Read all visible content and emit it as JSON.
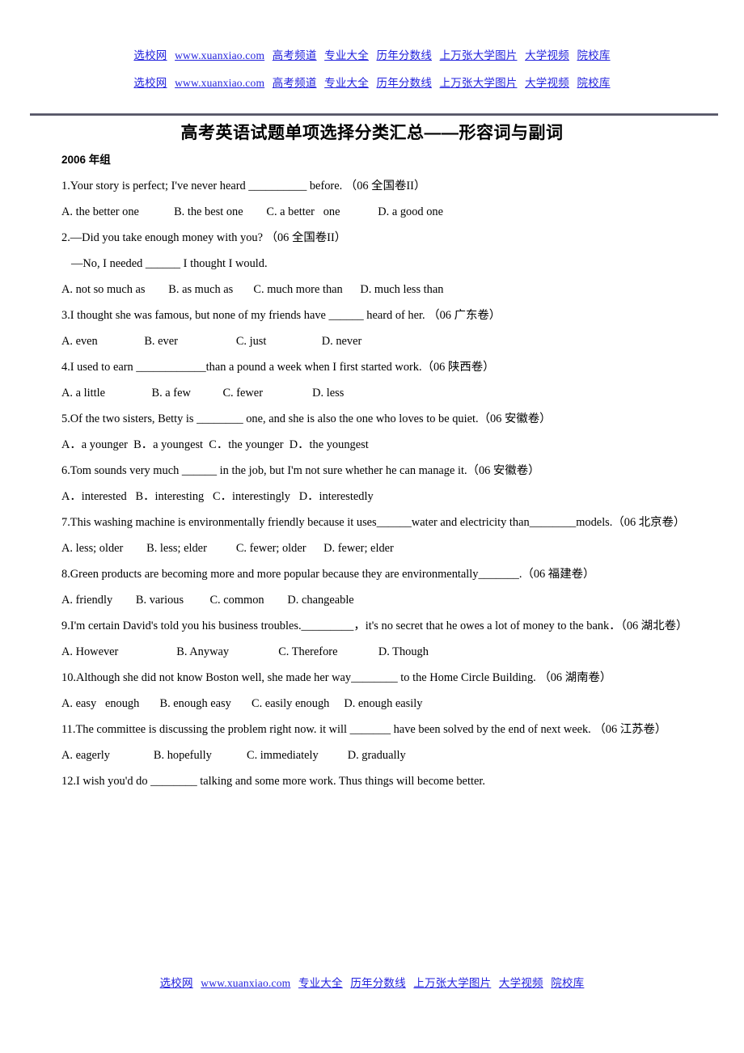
{
  "header": {
    "rows": [
      {
        "links": [
          "选校网",
          "www.xuanxiao.com",
          "高考频道",
          "专业大全",
          "历年分数线",
          "上万张大学图片",
          "大学视频",
          "院校库"
        ]
      },
      {
        "links": [
          "选校网",
          "www.xuanxiao.com",
          "高考频道",
          "专业大全",
          "历年分数线",
          "上万张大学图片",
          "大学视频",
          "院校库"
        ]
      }
    ],
    "link_color": "#2222dd"
  },
  "title": "高考英语试题单项选择分类汇总——形容词与副词",
  "section_heading": "2006 年组",
  "questions": [
    {
      "stem": "1.Your story is perfect; I've never heard __________ before. （06 全国卷II）",
      "options": "A. the better one            B. the best one        C. a better   one             D. a good one"
    },
    {
      "stem": "2.—Did you take enough money with you? （06 全国卷II）",
      "continuation": "—No, I needed ______ I thought I would.",
      "options": "A. not so much as        B. as much as       C. much more than      D. much less than"
    },
    {
      "stem": "3.I thought she was famous, but none of my friends have ______ heard of her. （06 广东卷）",
      "options": "A. even                B. ever                    C. just                   D. never"
    },
    {
      "stem": "4.I used to earn ____________than a pound a week when I first started work.（06 陕西卷）",
      "options": "A. a little                B. a few           C. fewer                 D. less"
    },
    {
      "stem": "5.Of the two sisters, Betty is ________ one, and she is also the one who loves to be quiet.（06 安徽卷）",
      "options": "A．a younger  B．a youngest  C．the younger  D．the youngest"
    },
    {
      "stem": "6.Tom sounds very much ______ in the job, but I'm not sure whether he can manage it.（06 安徽卷）",
      "options": "A．interested   B．interesting   C．interestingly   D．interestedly"
    },
    {
      "stem": "7.This washing machine is environmentally friendly because it uses______water and electricity than________models.（06 北京卷）",
      "options": "A. less; older        B. less; elder          C. fewer; older      D. fewer; elder"
    },
    {
      "stem": "8.Green products are becoming more and more popular because they are environmentally_______.（06 福建卷）",
      "options": "A. friendly        B. various         C. common        D. changeable"
    },
    {
      "stem": "9.I'm certain David's told you his business troubles._________，it's no secret that he owes a lot of money to the bank．（06 湖北卷）",
      "options": "A. However                    B. Anyway                 C. Therefore              D. Though"
    },
    {
      "stem": "10.Although she did not know Boston well, she made her way________ to the Home Circle Building. （06 湖南卷）",
      "options": "A. easy   enough       B. enough easy       C. easily enough     D. enough easily"
    },
    {
      "stem": "11.The committee is discussing the problem right now. it will _______ have been solved by the end of next week. （06 江苏卷）",
      "options": "A. eagerly               B. hopefully            C. immediately          D. gradually"
    },
    {
      "stem": "12.I wish you'd do ________ talking and some more work. Thus things will become better.",
      "options": ""
    }
  ],
  "footer": {
    "links": [
      "选校网",
      "www.xuanxiao.com",
      "专业大全",
      "历年分数线",
      "上万张大学图片",
      "大学视频",
      "院校库"
    ]
  }
}
